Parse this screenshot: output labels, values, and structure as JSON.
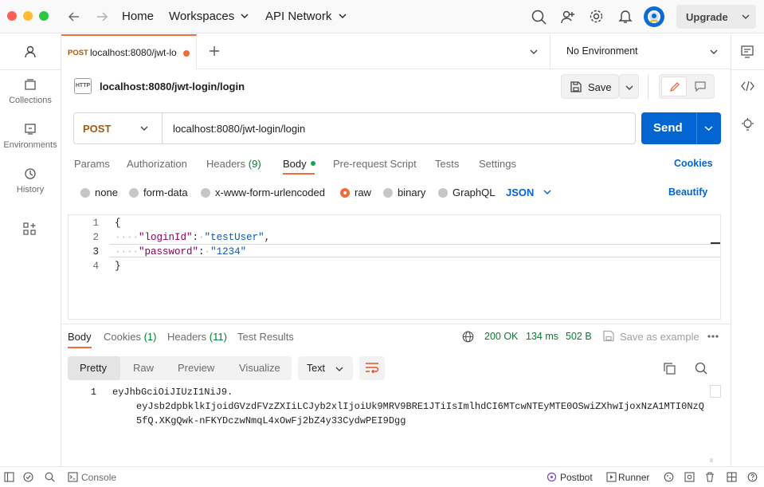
{
  "topbar": {
    "home": "Home",
    "workspaces": "Workspaces",
    "api_network": "API Network",
    "upgrade": "Upgrade"
  },
  "sidebar": {
    "items": [
      {
        "label": "Collections",
        "icon": "collections-icon"
      },
      {
        "label": "Environments",
        "icon": "environments-icon"
      },
      {
        "label": "History",
        "icon": "history-icon"
      }
    ]
  },
  "tab": {
    "method": "POST",
    "title": "localhost:8080/jwt-lo"
  },
  "environment": {
    "selected": "No Environment"
  },
  "request": {
    "name": "localhost:8080/jwt-login/login",
    "http_badge": "HTTP",
    "save_label": "Save",
    "method": "POST",
    "url": "localhost:8080/jwt-login/login",
    "send_label": "Send"
  },
  "request_tabs": {
    "params": "Params",
    "authorization": "Authorization",
    "headers": "Headers",
    "headers_count": "(9)",
    "body": "Body",
    "prerequest": "Pre-request Script",
    "tests": "Tests",
    "settings": "Settings",
    "cookies": "Cookies"
  },
  "body_types": {
    "none": "none",
    "form_data": "form-data",
    "urlencoded": "x-www-form-urlencoded",
    "raw": "raw",
    "binary": "binary",
    "graphql": "GraphQL",
    "format": "JSON",
    "beautify": "Beautify"
  },
  "editor": {
    "lines": [
      {
        "n": "1",
        "open": "{"
      },
      {
        "n": "2",
        "key": "\"loginId\"",
        "value": "\"testUser\"",
        "trail": ","
      },
      {
        "n": "3",
        "key": "\"password\"",
        "value": "\"1234\""
      },
      {
        "n": "4",
        "close": "}"
      }
    ]
  },
  "response": {
    "tabs": {
      "body": "Body",
      "cookies": "Cookies",
      "cookies_count": "(1)",
      "headers": "Headers",
      "headers_count": "(11)",
      "test_results": "Test Results"
    },
    "status": "200 OK",
    "time": "134 ms",
    "size": "502 B",
    "save_example": "Save as example",
    "views": {
      "pretty": "Pretty",
      "raw": "Raw",
      "preview": "Preview",
      "visualize": "Visualize"
    },
    "format": "Text",
    "line_no": "1",
    "body_lines": [
      "eyJhbGciOiJIUzI1NiJ9.",
      "eyJsb2dpbklkIjoidGVzdFVzZXIiLCJyb2xlIjoiUk9MRV9BRE1JTiIsImlhdCI6MTcwNTEyMTE0OSwiZXhwIjoxNzA1MTI0NzQ",
      "5fQ.XKgQwk-nFKYDczwNmqL4xOwFj2bZ4y33CydwPEI9Dgg"
    ]
  },
  "statusbar": {
    "console": "Console",
    "postbot": "Postbot",
    "runner": "Runner"
  },
  "colors": {
    "accent_orange": "#f26b3a",
    "send_blue": "#0265d2",
    "ok_green": "#007f31",
    "link_blue": "#0265d2"
  }
}
